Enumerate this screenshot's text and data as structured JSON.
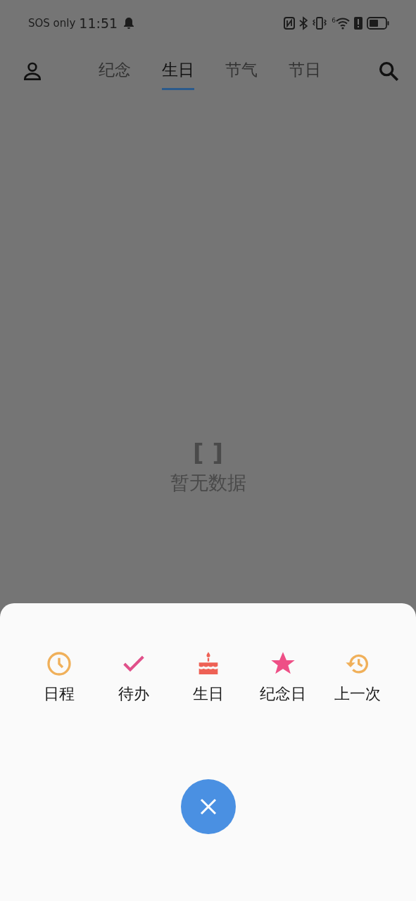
{
  "status_bar": {
    "carrier": "SOS only",
    "time": "11:51",
    "wifi_badge": "6"
  },
  "tabs": [
    {
      "label": "纪念",
      "selected": false
    },
    {
      "label": "生日",
      "selected": true
    },
    {
      "label": "节气",
      "selected": false
    },
    {
      "label": "节日",
      "selected": false
    }
  ],
  "empty_state": {
    "mark": "[ ]",
    "text": "暂无数据"
  },
  "sheet": {
    "actions": [
      {
        "kind": "clock",
        "label": "日程",
        "color": "#f0b05a"
      },
      {
        "kind": "check",
        "label": "待办",
        "color": "#e0508a"
      },
      {
        "kind": "cake",
        "label": "生日",
        "color": "#ee6155"
      },
      {
        "kind": "star",
        "label": "纪念日",
        "color": "#ee4f86"
      },
      {
        "kind": "history",
        "label": "上一次",
        "color": "#f0b05a"
      }
    ]
  }
}
